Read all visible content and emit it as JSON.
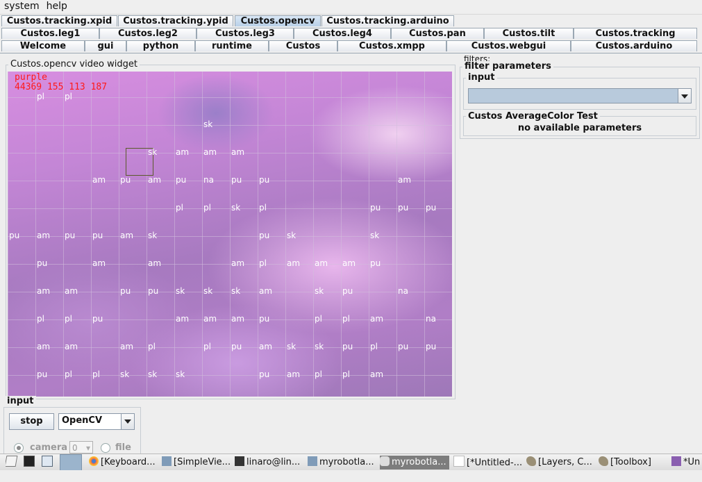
{
  "menu": {
    "system": "system",
    "help": "help"
  },
  "tabs": {
    "row1": [
      "Custos.tracking.xpid",
      "Custos.tracking.ypid",
      "Custos.opencv",
      "Custos.tracking.arduino"
    ],
    "row2": [
      "Custos.leg1",
      "Custos.leg2",
      "Custos.leg3",
      "Custos.leg4",
      "Custos.pan",
      "Custos.tilt",
      "Custos.tracking"
    ],
    "row3": [
      "Welcome",
      "gui",
      "python",
      "runtime",
      "Custos",
      "Custos.xmpp",
      "Custos.webgui",
      "Custos.arduino"
    ],
    "selected": "Custos.opencv"
  },
  "video": {
    "legend": "Custos.opencv  video widget",
    "color_name": "purple",
    "stats": "44369 155 113 187",
    "grid_labels": [
      [
        null,
        "pl",
        "pl",
        null,
        null,
        null,
        null,
        null,
        null,
        null,
        null,
        null,
        null,
        null,
        null,
        null
      ],
      [
        null,
        null,
        null,
        null,
        null,
        null,
        null,
        "sk",
        null,
        null,
        null,
        null,
        null,
        null,
        null,
        null
      ],
      [
        null,
        null,
        null,
        null,
        null,
        "sk",
        "am",
        "am",
        "am",
        null,
        null,
        null,
        null,
        null,
        null,
        null
      ],
      [
        null,
        null,
        null,
        "am",
        "pu",
        "am",
        "pu",
        "na",
        "pu",
        "pu",
        null,
        null,
        null,
        null,
        "am",
        null
      ],
      [
        null,
        null,
        null,
        null,
        null,
        null,
        "pl",
        "pl",
        "sk",
        "pl",
        null,
        null,
        null,
        "pu",
        "pu",
        "pu"
      ],
      [
        "pu",
        "am",
        "pu",
        "pu",
        "am",
        "sk",
        null,
        null,
        null,
        "pu",
        "sk",
        null,
        null,
        "sk",
        null,
        null
      ],
      [
        null,
        "pu",
        null,
        "am",
        null,
        "am",
        null,
        null,
        "am",
        "pl",
        "am",
        "am",
        "am",
        "pu",
        null,
        null
      ],
      [
        null,
        "am",
        "am",
        null,
        "pu",
        "pu",
        "sk",
        "sk",
        "sk",
        "am",
        null,
        "sk",
        "pu",
        null,
        "na",
        null
      ],
      [
        null,
        "pl",
        "pl",
        "pu",
        null,
        null,
        "am",
        "am",
        "am",
        "pu",
        null,
        "pl",
        "pl",
        "am",
        null,
        "na"
      ],
      [
        null,
        "am",
        "am",
        null,
        "am",
        "pl",
        null,
        "pl",
        "pu",
        "am",
        "sk",
        "sk",
        "pu",
        "pl",
        "pu",
        "pu"
      ],
      [
        null,
        "pu",
        "pl",
        "pl",
        "sk",
        "sk",
        "sk",
        null,
        null,
        "pu",
        "am",
        "pl",
        "pl",
        "am",
        null,
        null
      ],
      [
        null,
        "am",
        null,
        null,
        "am",
        "am",
        "am",
        "pu",
        null,
        null,
        "pu",
        "pu",
        "am",
        "pu",
        "am",
        null
      ]
    ]
  },
  "filters": {
    "legend": "filters:",
    "params_legend": "filter parameters",
    "input_legend": "input",
    "input_value": "",
    "test_legend": "Custos AverageColor Test",
    "test_text": "no available parameters"
  },
  "input_panel": {
    "legend": "input",
    "stop_label": "stop",
    "grabber_value": "OpenCV",
    "camera_label": "camera",
    "camera_index": "0",
    "file_label": "file"
  },
  "taskbar": {
    "items": [
      "[Keyboard...",
      "[SimpleVie...",
      "linaro@lin...",
      "myrobotla...",
      "myrobotla...",
      "[*Untitled-...",
      "[Layers, C...",
      "[Toolbox]",
      "*Un"
    ]
  }
}
